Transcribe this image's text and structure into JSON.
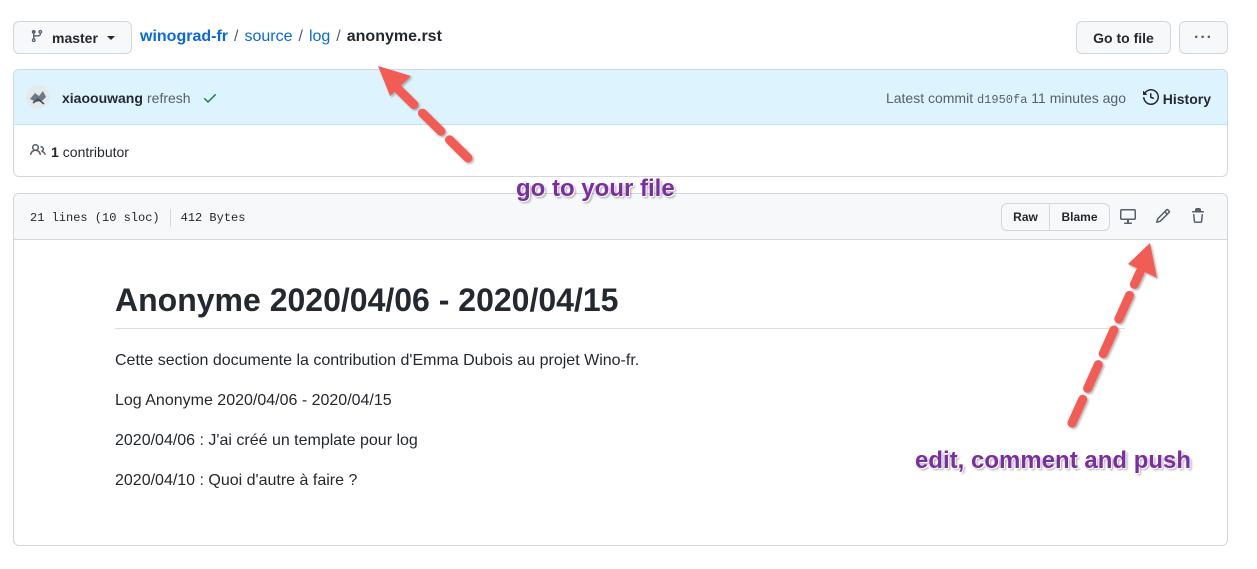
{
  "branch": {
    "label": "master"
  },
  "breadcrumb": {
    "repo": "winograd-fr",
    "sep": "/",
    "dir1": "source",
    "dir2": "log",
    "file": "anonyme.rst"
  },
  "toolbar": {
    "goto_label": "Go to file",
    "more_label": "···"
  },
  "commit": {
    "author": "xiaoouwang",
    "message": "refresh",
    "latest_label": "Latest commit",
    "sha": "d1950fa",
    "time": "11 minutes ago",
    "history_label": "History"
  },
  "contributors": {
    "count": "1",
    "label": "contributor"
  },
  "file": {
    "lines": "21 lines (10 sloc)",
    "size": "412 Bytes",
    "raw_label": "Raw",
    "blame_label": "Blame",
    "icons": [
      "display-icon",
      "pencil-icon",
      "trash-icon"
    ]
  },
  "content": {
    "title": "Anonyme 2020/04/06 - 2020/04/15",
    "paragraphs": [
      "Cette section documente la contribution d'Emma Dubois au projet Wino-fr.",
      "Log Anonyme 2020/04/06 - 2020/04/15",
      "2020/04/06 : J'ai créé un template pour log",
      "2020/04/10 : Quoi d'autre à faire ?"
    ]
  },
  "annotations": {
    "goto_file": "go to your file",
    "edit": "edit, comment and push"
  },
  "colors": {
    "link": "#0969da",
    "commit_bg": "#ddf4ff",
    "success": "#1a7f37",
    "annotation_text": "#7a2ea0",
    "arrow": "#f25c54"
  }
}
